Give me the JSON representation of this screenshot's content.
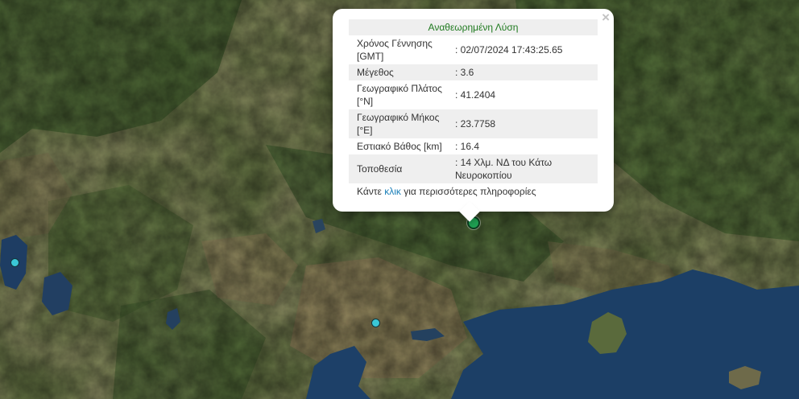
{
  "popup": {
    "title": "Αναθεωρημένη Λύση",
    "close_icon": "×",
    "rows": [
      {
        "label": "Χρόνος Γέννησης [GMT]",
        "value": ": 02/07/2024 17:43:25.65"
      },
      {
        "label": "Μέγεθος",
        "value": ": 3.6"
      },
      {
        "label": "Γεωγραφικό Πλάτος [°N]",
        "value": ": 41.2404"
      },
      {
        "label": "Γεωγραφικό Μήκος [°E]",
        "value": ": 23.7758"
      },
      {
        "label": "Εστιακό Βάθος [km]",
        "value": ": 16.4"
      },
      {
        "label": "Τοποθεσία",
        "value": ": 14 Χλμ. ΝΔ του Κάτω Νευροκοπίου"
      }
    ],
    "footer_before": "Κάντε ",
    "footer_link": "κλικ",
    "footer_after": " για περισσότερες πληροφορίες"
  },
  "markers": {
    "main_color": "#1f9f52",
    "other_color": "#3ac7d6"
  },
  "colors": {
    "popup_title": "#1f7a1f",
    "link": "#1a7fb8",
    "sea": "#1c3f66"
  }
}
